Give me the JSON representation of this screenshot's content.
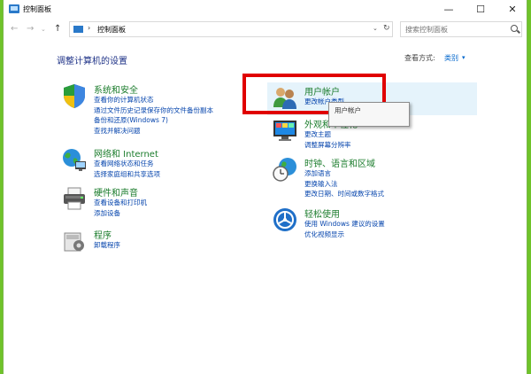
{
  "window": {
    "title": "控制面板",
    "controls": {
      "minimize": "—",
      "maximize": "☐",
      "close": "✕"
    }
  },
  "address": {
    "path": "控制面板",
    "separator": "›",
    "search_placeholder": "搜索控制面板"
  },
  "nav": {
    "back": "←",
    "forward": "→",
    "recent": "⌄",
    "up": "↑",
    "dropdown": "⌄",
    "refresh": "↻"
  },
  "page": {
    "title": "调整计算机的设置",
    "view_by_label": "查看方式:",
    "view_by_value": "类别",
    "view_by_caret": "▾"
  },
  "categories": {
    "security": {
      "title": "系统和安全",
      "icon": "shield-icon",
      "links": [
        "查看你的计算机状态",
        "通过文件历史记录保存你的文件备份副本",
        "备份和还原(Windows 7)",
        "查找并解决问题"
      ]
    },
    "network": {
      "title": "网络和 Internet",
      "icon": "globe-network-icon",
      "links": [
        "查看网络状态和任务",
        "选择家庭组和共享选项"
      ]
    },
    "hardware": {
      "title": "硬件和声音",
      "icon": "printer-icon",
      "links": [
        "查看设备和打印机",
        "添加设备"
      ]
    },
    "programs": {
      "title": "程序",
      "icon": "programs-icon",
      "links": [
        "卸载程序"
      ]
    },
    "users": {
      "title": "用户帐户",
      "icon": "users-icon",
      "links": [
        "更改帐户类型"
      ]
    },
    "appearance": {
      "title": "外观和个性化",
      "icon": "monitor-icon",
      "links": [
        "更改主题",
        "调整屏幕分辨率"
      ]
    },
    "clock": {
      "title": "时钟、语言和区域",
      "icon": "clock-globe-icon",
      "links": [
        "添加语言",
        "更换输入法",
        "更改日期、时间或数字格式"
      ]
    },
    "ease": {
      "title": "轻松使用",
      "icon": "ease-of-access-icon",
      "links": [
        "使用 Windows 建议的设置",
        "优化视频显示"
      ]
    }
  },
  "tooltip": {
    "text": "用户帐户"
  },
  "colors": {
    "accent_green": "#6fc32a",
    "category_green": "#1b7c2c",
    "link_blue": "#0645ad",
    "highlight": "#e00000"
  }
}
